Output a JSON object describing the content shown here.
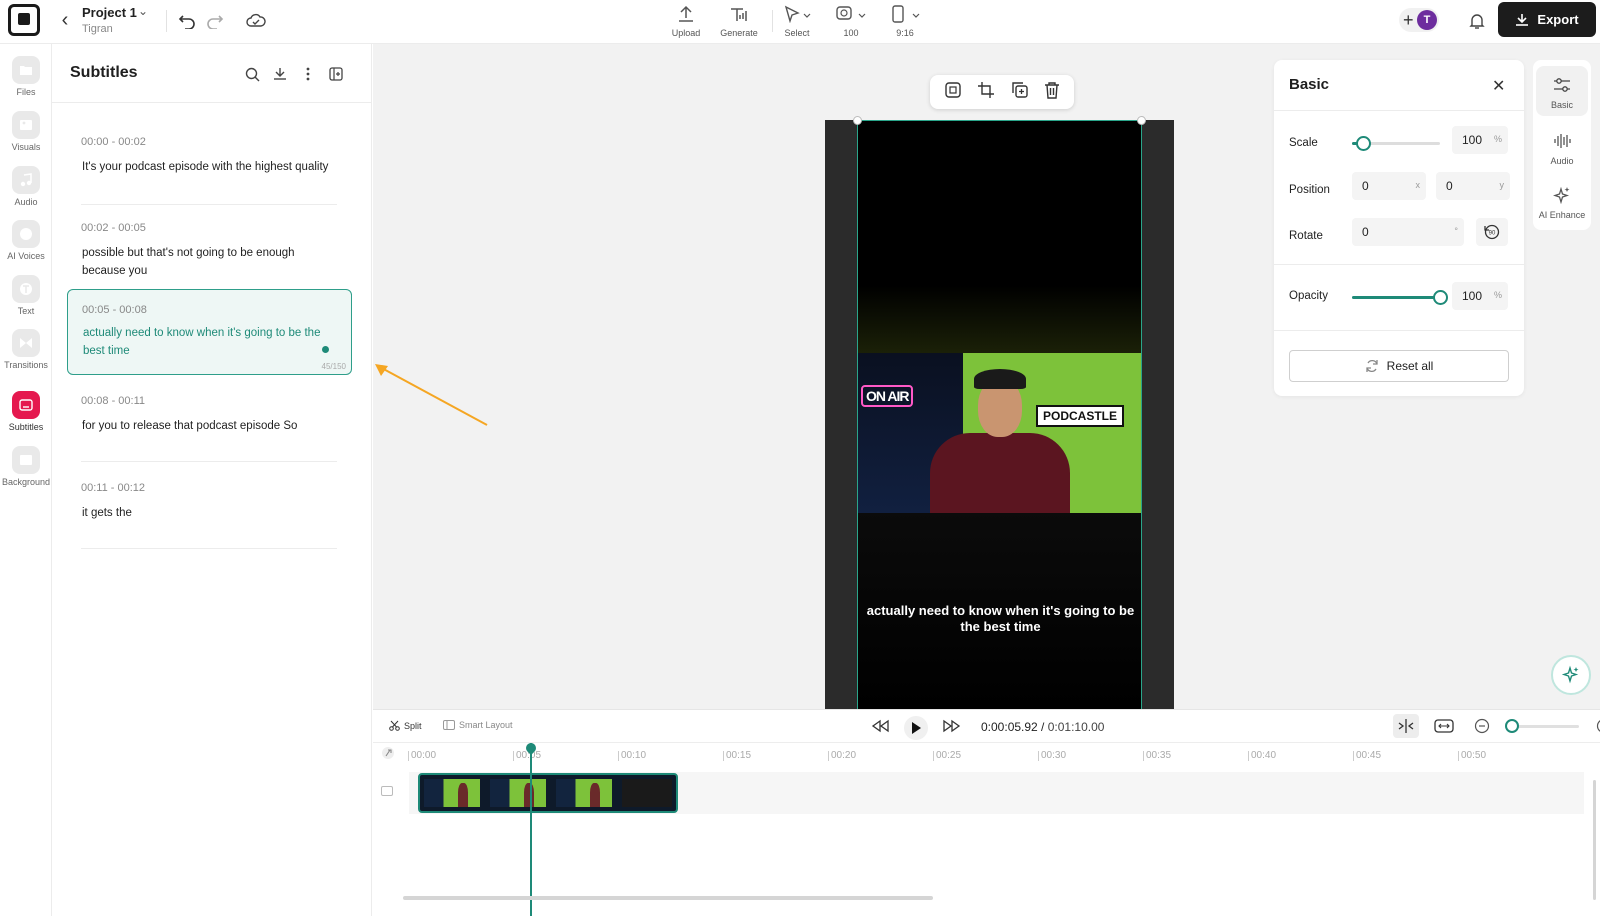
{
  "project": {
    "title": "Project 1",
    "owner": "Tigran"
  },
  "toolbar": {
    "upload": "Upload",
    "generate": "Generate",
    "select": "Select",
    "zoom": "100",
    "ratio": "9:16",
    "avatar_initial": "T",
    "export": "Export"
  },
  "rail": {
    "items": [
      {
        "label": "Files",
        "icon": "folder-icon"
      },
      {
        "label": "Visuals",
        "icon": "image-icon"
      },
      {
        "label": "Audio",
        "icon": "music-note-icon"
      },
      {
        "label": "AI Voices",
        "icon": "voice-icon"
      },
      {
        "label": "Text",
        "icon": "text-icon"
      },
      {
        "label": "Transitions",
        "icon": "transition-icon"
      },
      {
        "label": "Subtitles",
        "icon": "subtitles-icon"
      },
      {
        "label": "Background",
        "icon": "background-icon"
      }
    ],
    "active": "Subtitles"
  },
  "subtitles": {
    "title": "Subtitles",
    "items": [
      {
        "time": "00:00 - 00:02",
        "text": "It's your podcast episode with the highest quality"
      },
      {
        "time": "00:02 - 00:05",
        "text": "possible but that's not going to be enough because you"
      },
      {
        "time": "00:05 - 00:08",
        "text": "actually need to know when it's going to be the best time",
        "counter": "45/150",
        "active": true
      },
      {
        "time": "00:08 - 00:11",
        "text": "for you to release that podcast episode So"
      },
      {
        "time": "00:11 - 00:12",
        "text": "it gets the"
      }
    ]
  },
  "video": {
    "caption": "actually need to know when it's going to be the best time",
    "sign_on_air": "ON AIR",
    "sign_podcastle": "PODCASTLE"
  },
  "basic_panel": {
    "title": "Basic",
    "scale_label": "Scale",
    "scale_value": "100",
    "scale_unit": "%",
    "scale_level": 0.12,
    "position_label": "Position",
    "position_x": "0",
    "position_x_unit": "x",
    "position_y": "0",
    "position_y_unit": "y",
    "rotate_label": "Rotate",
    "rotate_value": "0",
    "rotate_unit": "°",
    "rotate_button": "90",
    "opacity_label": "Opacity",
    "opacity_value": "100",
    "opacity_unit": "%",
    "opacity_level": 1.0,
    "reset_label": "Reset all"
  },
  "right_rail": {
    "items": [
      {
        "label": "Basic",
        "icon": "sliders-icon"
      },
      {
        "label": "Audio",
        "icon": "waveform-icon"
      },
      {
        "label": "AI Enhance",
        "icon": "sparkle-icon"
      }
    ]
  },
  "timeline": {
    "split": "Split",
    "smart_layout": "Smart Layout",
    "current_time": "0:00:05.92",
    "total_time": "0:01:10.00",
    "ticks": [
      "00:00",
      "00:05",
      "00:10",
      "00:15",
      "00:20",
      "00:25",
      "00:30",
      "00:35",
      "00:40",
      "00:45",
      "00:50"
    ]
  },
  "colors": {
    "accent": "#1e8a78",
    "subtitles_active": "#e5194f",
    "export_bg": "#1c1c1c",
    "annotation_arrow": "#f5a623"
  }
}
